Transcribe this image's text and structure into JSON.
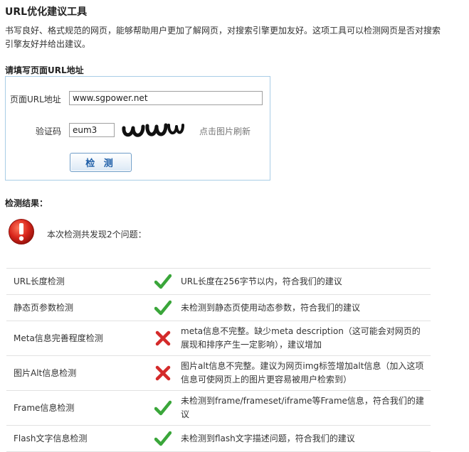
{
  "page": {
    "title": "URL优化建议工具",
    "intro": "书写良好、格式规范的网页，能够帮助用户更加了解网页，对搜索引擎更加友好。这项工具可以检测网页是否对搜索引擎友好并给出建议。"
  },
  "form": {
    "heading": "请填写页面URL地址",
    "url_label": "页面URL地址",
    "url_value": "www.sgpower.net",
    "captcha_label": "验证码",
    "captcha_value": "eum3",
    "captcha_hint": "点击图片刷新",
    "submit_label": "检 测"
  },
  "results": {
    "heading": "检测结果：",
    "summary": "本次检测共发现2个问题：",
    "items": [
      {
        "name": "URL长度检测",
        "status": "pass",
        "status_icon": "check-icon",
        "message": "URL长度在256字节以内，符合我们的建议"
      },
      {
        "name": "静态页参数检测",
        "status": "pass",
        "status_icon": "check-icon",
        "message": "未检测到静态页使用动态参数，符合我们的建议"
      },
      {
        "name": "Meta信息完善程度检测",
        "status": "fail",
        "status_icon": "cross-icon",
        "message": "meta信息不完整。缺少meta description（这可能会对网页的展现和排序产生一定影响），建议增加"
      },
      {
        "name": "图片Alt信息检测",
        "status": "fail",
        "status_icon": "cross-icon",
        "message": "图片alt信息不完整。建议为网页img标签增加alt信息（加入这项信息可使网页上的图片更容易被用户检索到）"
      },
      {
        "name": "Frame信息检测",
        "status": "pass",
        "status_icon": "check-icon",
        "message": "未检测到frame/frameset/iframe等Frame信息，符合我们的建议"
      },
      {
        "name": "Flash文字信息检测",
        "status": "pass",
        "status_icon": "check-icon",
        "message": "未检测到flash文字描述问题，符合我们的建议"
      }
    ]
  },
  "colors": {
    "form_border": "#a9cde6",
    "pass_green": "#3aa63a",
    "fail_red": "#d42a2a",
    "alert_red": "#d9261c",
    "button_text": "#1f5fa8"
  }
}
